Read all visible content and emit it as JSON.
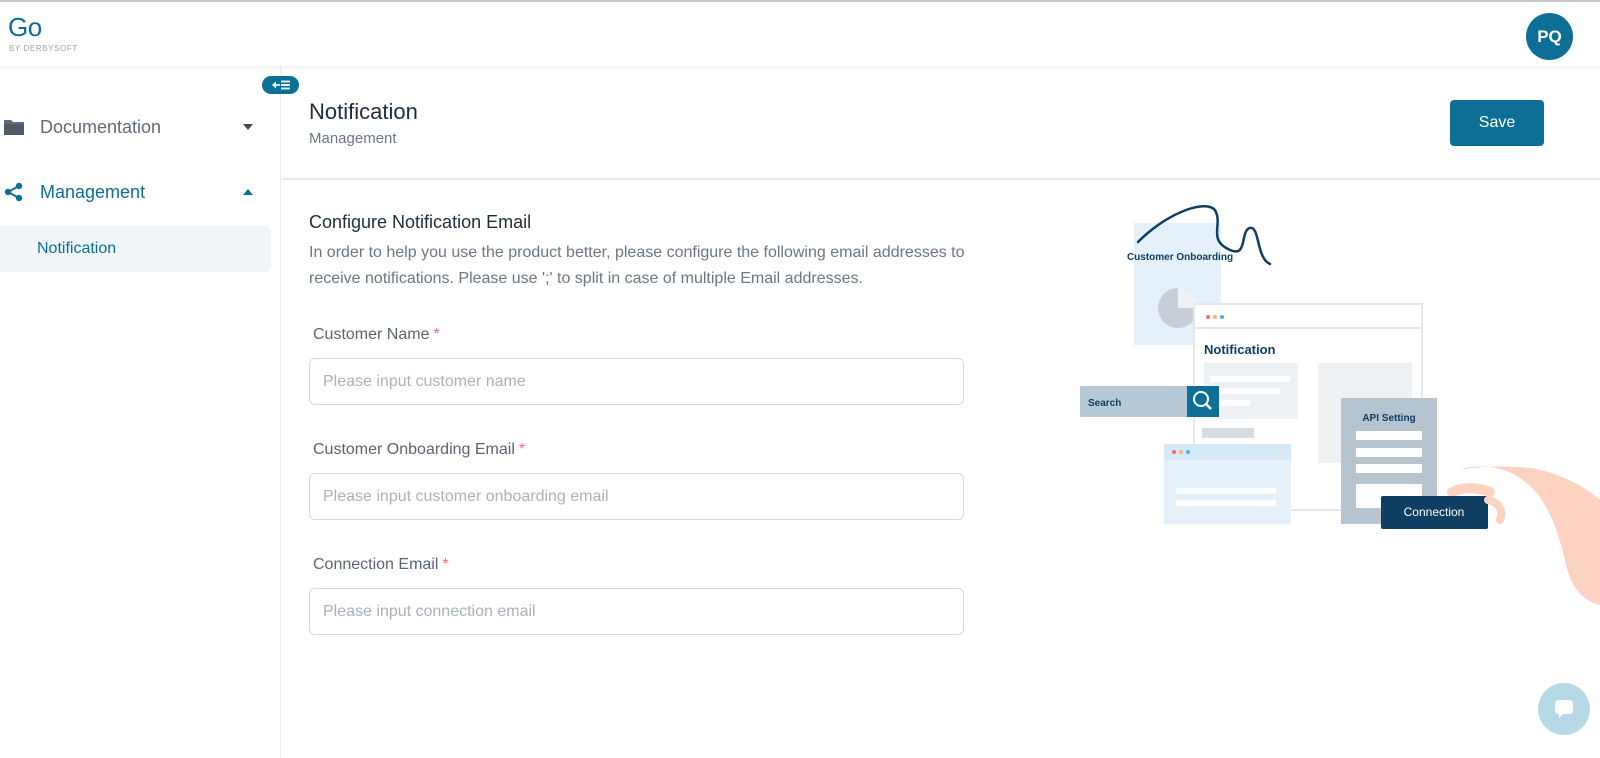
{
  "app": {
    "logo_main": "Go",
    "logo_sub": "BY DERBYSOFT",
    "avatar_initials": "PQ"
  },
  "sidebar": {
    "items": [
      {
        "label": "Documentation",
        "icon": "folder-icon",
        "expanded": false,
        "color": "#5f6b78"
      },
      {
        "label": "Management",
        "icon": "share-icon",
        "expanded": true,
        "color": "#0d6f96"
      }
    ],
    "sub_items": [
      {
        "label": "Notification",
        "active": true
      }
    ]
  },
  "header": {
    "title": "Notification",
    "subtitle": "Management",
    "save_label": "Save"
  },
  "form": {
    "section_title": "Configure Notification Email",
    "section_desc": "In order to help you use the product better, please configure the following email addresses to receive notifications. Please use ';' to split in case of multiple Email addresses.",
    "fields": [
      {
        "label": "Customer Name",
        "required_mark": "*",
        "value": "",
        "placeholder": "Please input customer name"
      },
      {
        "label": "Customer Onboarding Email",
        "required_mark": "*",
        "value": "",
        "placeholder": "Please input customer onboarding email"
      },
      {
        "label": "Connection Email",
        "required_mark": "*",
        "value": "",
        "placeholder": "Please input connection email"
      }
    ]
  },
  "illustration": {
    "card_customer_onboarding": "Customer Onboarding",
    "card_notification": "Notification",
    "search_label": "Search",
    "api_setting": "API Setting",
    "connection": "Connection"
  },
  "colors": {
    "primary": "#0d6f96",
    "required": "#f56c6c",
    "active_bg": "#f0f6fa",
    "navy": "#0f3e63"
  }
}
